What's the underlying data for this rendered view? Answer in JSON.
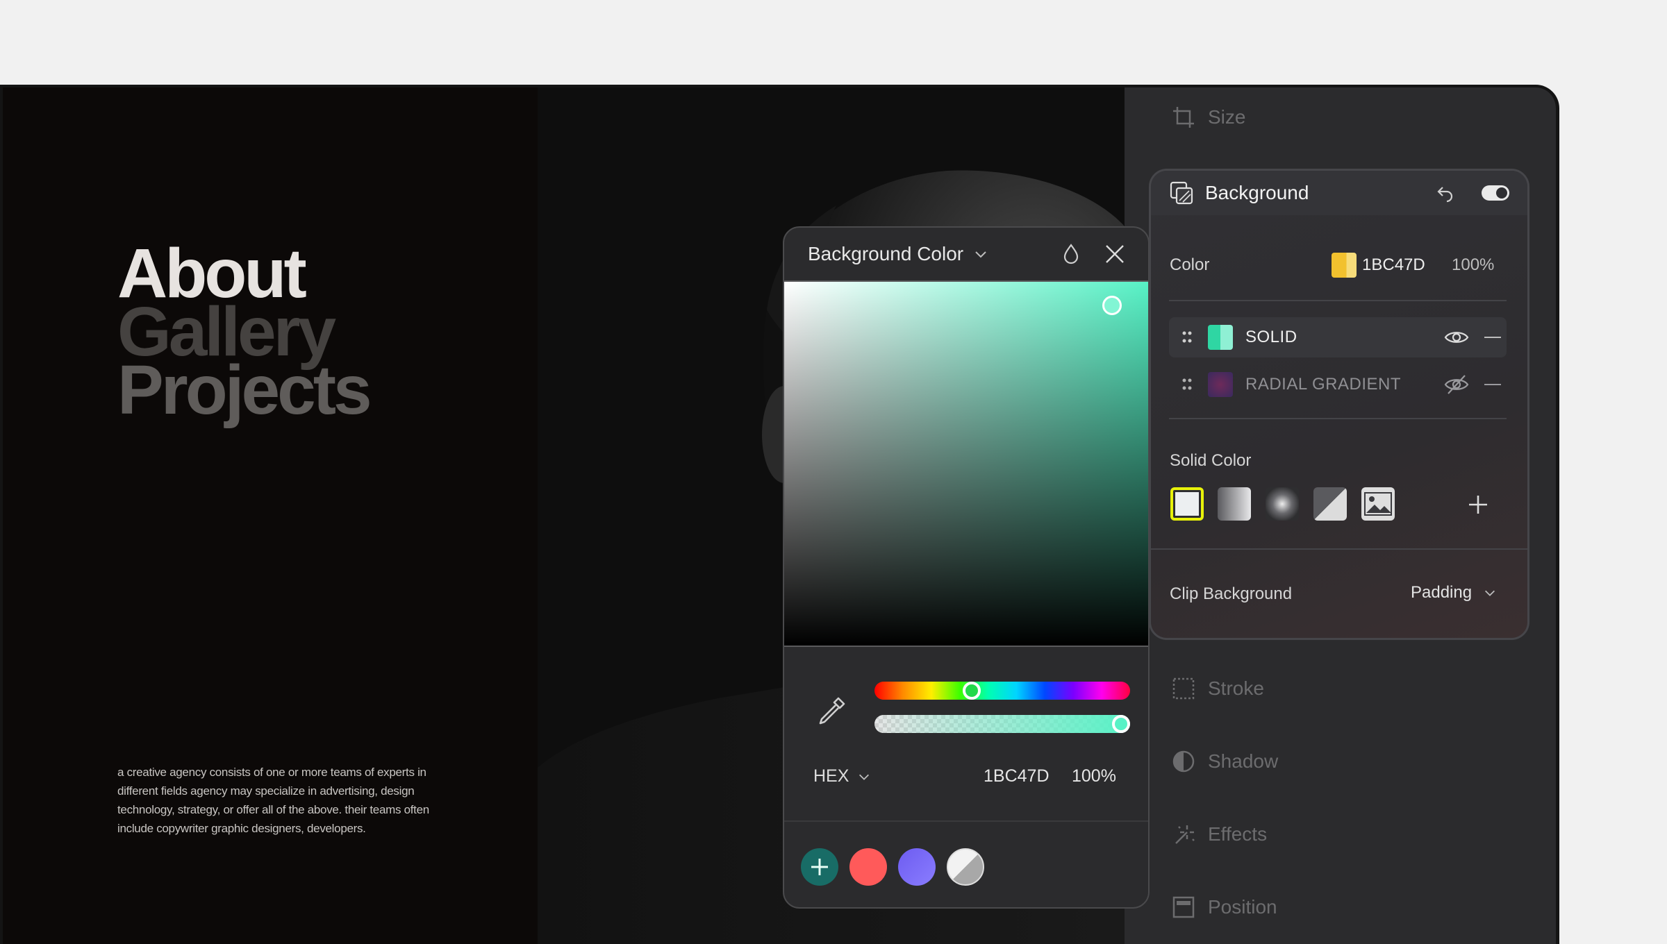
{
  "hero": {
    "line1": "About",
    "line2": "Gallery",
    "line3": "Projects"
  },
  "blurb": "a creative agency consists of one or more teams of experts in different fields agency may specialize in advertising, design technology, strategy, or offer all of the above. their teams often include copywriter graphic designers, developers.",
  "sidebar": {
    "size": "Size",
    "stroke": "Stroke",
    "shadow": "Shadow",
    "effects": "Effects",
    "position": "Position"
  },
  "picker": {
    "title": "Background Color",
    "format": "HEX",
    "hex": "1BC47D",
    "opacity": "100%",
    "hue_fraction": 0.37,
    "alpha_fraction": 1.0,
    "swatches": [
      "#ff5a5a",
      "#7b67f0",
      "#c8c8c8"
    ]
  },
  "background_panel": {
    "title": "Background",
    "color_label": "Color",
    "color_hex": "1BC47D",
    "color_opacity": "100%",
    "layers": [
      {
        "label": "SOLID",
        "visible": true
      },
      {
        "label": "RADIAL GRADIENT",
        "visible": false
      }
    ],
    "solid_color_label": "Solid Color",
    "clip_label": "Clip Background",
    "clip_value": "Padding"
  },
  "colors": {
    "accent": "#1BC47D",
    "mint": "#57f2c6",
    "highlight": "#e8f20a"
  }
}
